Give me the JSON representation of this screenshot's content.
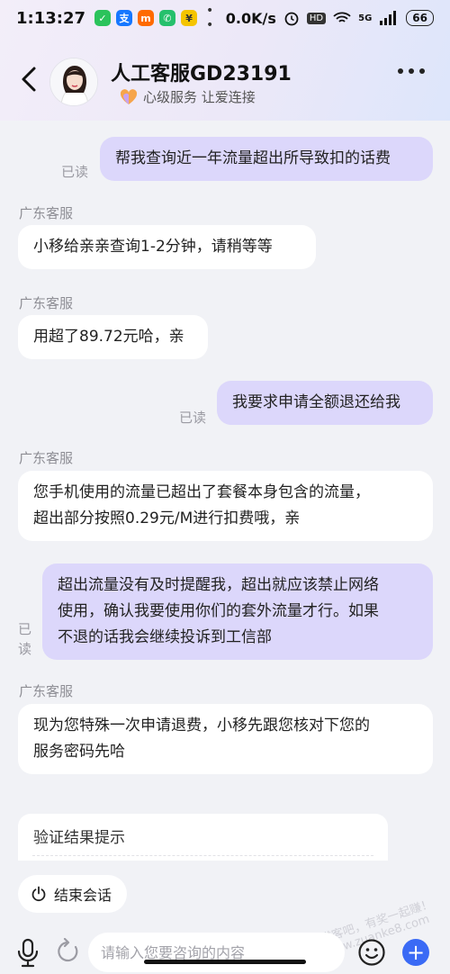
{
  "status_bar": {
    "time": "1:13:27",
    "apps": [
      "wechat",
      "alipay",
      "mi",
      "phone",
      "bank"
    ],
    "dots": "• •",
    "network_speed": "0.0K/s",
    "hd": "HD",
    "signal": "5G",
    "battery": "66"
  },
  "header": {
    "agent_name": "人工客服GD23191",
    "agent_subtitle": "心级服务 让爱连接"
  },
  "messages": [
    {
      "from": "user",
      "read": "已读",
      "text": "帮我查询近一年流量超出所导致扣的话费"
    },
    {
      "from": "agent",
      "sender": "广东客服",
      "text": "小移给亲亲查询1-2分钟，请稍等等"
    },
    {
      "from": "agent",
      "sender": "广东客服",
      "text": "用超了89.72元哈，亲"
    },
    {
      "from": "user",
      "read": "已读",
      "text": "我要求申请全额退还给我"
    },
    {
      "from": "agent",
      "sender": "广东客服",
      "lines": [
        "您手机使用的流量已超出了套餐本身包含的流量，",
        "超出部分按照0.29元/M进行扣费哦，亲"
      ]
    },
    {
      "from": "user",
      "read": "已读",
      "lines": [
        "超出流量没有及时提醒我，超出就应该禁止网络",
        "使用，确认我要使用你们的套外流量才行。如果",
        "不退的话我会继续投诉到工信部"
      ]
    },
    {
      "from": "agent",
      "sender": "广东客服",
      "lines": [
        "现为您特殊一次申请退费，小移先跟您核对下您的",
        "服务密码先哈"
      ]
    }
  ],
  "verify_card": {
    "title": "验证结果提示"
  },
  "end_session": {
    "label": "结束会话"
  },
  "input": {
    "placeholder": "请输入您要咨询的内容"
  },
  "watermark": "赚客吧，有奖一起赚！www.zuanke8.com",
  "colors": {
    "user_bubble": "#dcd7fb",
    "agent_bubble": "#ffffff",
    "accent": "#3a6af5"
  }
}
